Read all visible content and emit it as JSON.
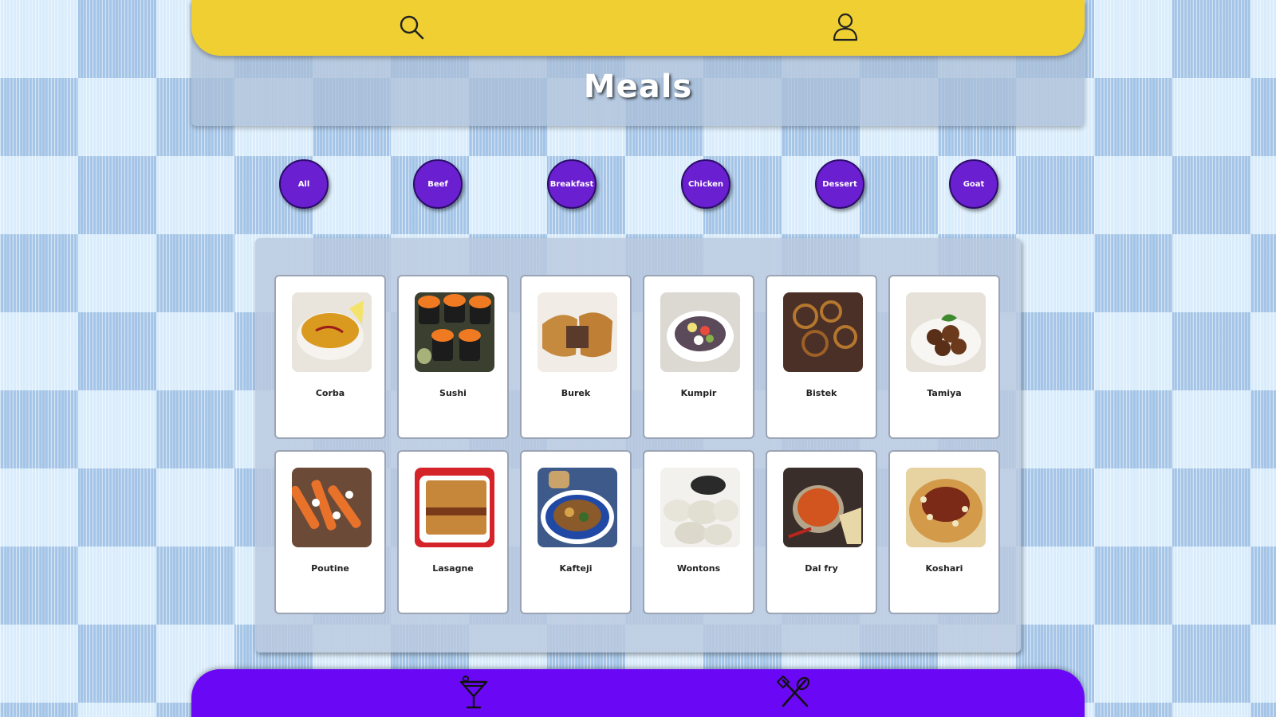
{
  "header": {
    "search_icon": "search-icon",
    "profile_icon": "user-icon",
    "accent_color": "#efcf32"
  },
  "page": {
    "title": "Meals"
  },
  "filters": {
    "accent_color": "#6a1fd0",
    "items": [
      {
        "label": "All"
      },
      {
        "label": "Beef"
      },
      {
        "label": "Breakfast"
      },
      {
        "label": "Chicken"
      },
      {
        "label": "Dessert"
      },
      {
        "label": "Goat"
      }
    ]
  },
  "meals": [
    {
      "name": "Corba"
    },
    {
      "name": "Sushi"
    },
    {
      "name": "Burek"
    },
    {
      "name": "Kumpir"
    },
    {
      "name": "Bistek"
    },
    {
      "name": "Tamiya"
    },
    {
      "name": "Poutine"
    },
    {
      "name": "Lasagne"
    },
    {
      "name": "Kafteji"
    },
    {
      "name": "Wontons"
    },
    {
      "name": "Dal fry"
    },
    {
      "name": "Koshari"
    }
  ],
  "footer": {
    "drinks_icon": "cocktail-icon",
    "meals_icon": "utensils-icon",
    "accent_color": "#6a07f4"
  }
}
